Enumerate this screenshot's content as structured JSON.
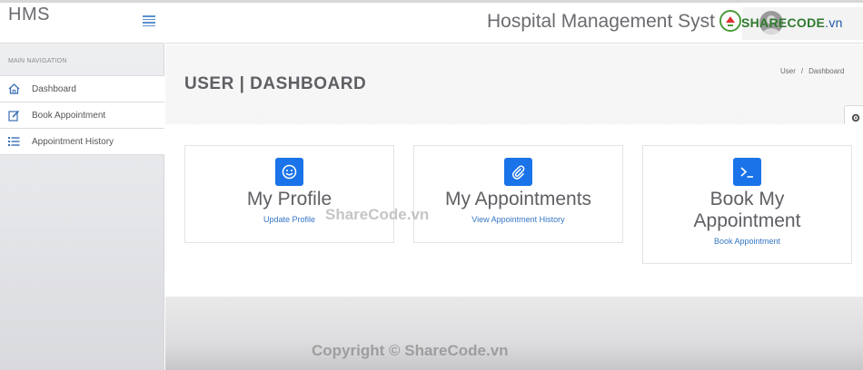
{
  "brand": "HMS",
  "sidebar": {
    "heading": "MAIN NAVIGATION",
    "items": [
      {
        "label": "Dashboard",
        "icon": "home-icon"
      },
      {
        "label": "Book Appointment",
        "icon": "edit-icon"
      },
      {
        "label": "Appointment History",
        "icon": "list-icon"
      }
    ]
  },
  "header": {
    "title": "Hospital Management Syst"
  },
  "logo": {
    "text": "SHARECODE",
    "tail": ".vn"
  },
  "page": {
    "title": "USER | DASHBOARD",
    "breadcrumb": [
      "User",
      "/",
      "Dashboard"
    ]
  },
  "cards": [
    {
      "title": "My Profile",
      "link": "Update Profile",
      "icon": "smile-icon"
    },
    {
      "title": "My Appointments",
      "link": "View Appointment History",
      "icon": "paperclip-icon"
    },
    {
      "title_line1": "Book My",
      "title_line2": "Appointment",
      "link": "Book Appointment",
      "icon": "terminal-icon"
    }
  ],
  "watermarks": {
    "center": "ShareCode.vn",
    "footer": "Copyright © ShareCode.vn"
  },
  "colors": {
    "accent": "#1a73e8",
    "link": "#3576c4",
    "logo_green": "#2f7a2f"
  }
}
